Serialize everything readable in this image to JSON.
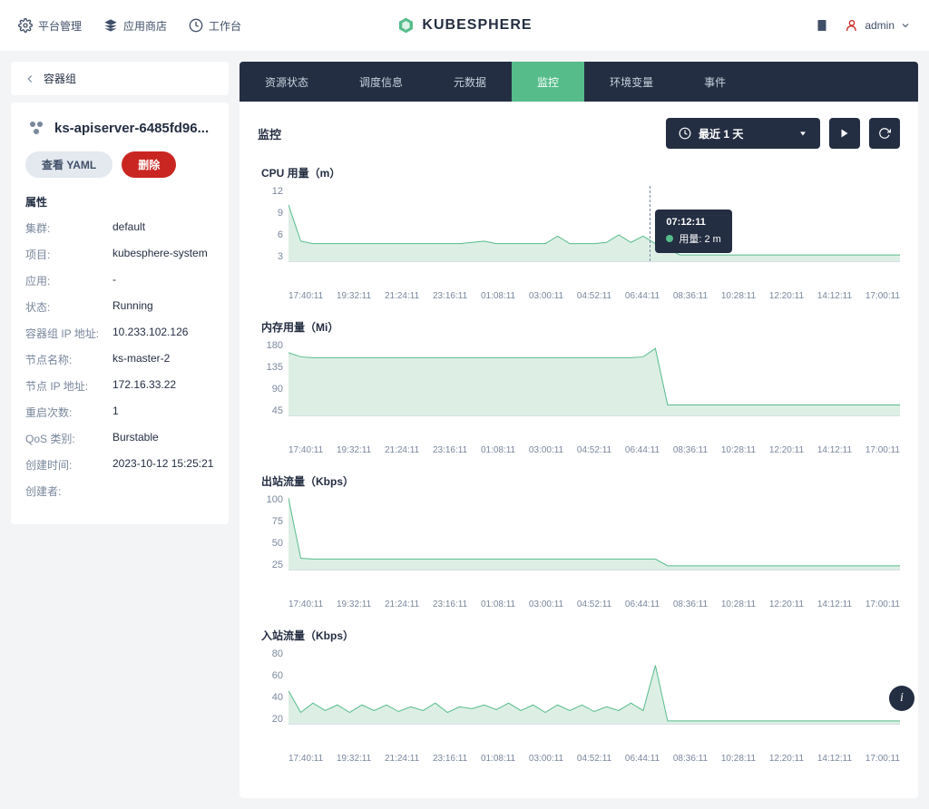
{
  "topbar": {
    "platform": "平台管理",
    "appstore": "应用商店",
    "workbench": "工作台",
    "brand": "KUBESPHERE",
    "user": "admin"
  },
  "breadcrumb": "容器组",
  "pod": {
    "name": "ks-apiserver-6485fd96..."
  },
  "buttons": {
    "yaml": "查看 YAML",
    "delete": "删除"
  },
  "attrs": {
    "title": "属性",
    "rows": [
      {
        "label": "集群:",
        "value": "default"
      },
      {
        "label": "项目:",
        "value": "kubesphere-system"
      },
      {
        "label": "应用:",
        "value": "-"
      },
      {
        "label": "状态:",
        "value": "Running"
      },
      {
        "label": "容器组 IP 地址:",
        "value": "10.233.102.126"
      },
      {
        "label": "节点名称:",
        "value": "ks-master-2"
      },
      {
        "label": "节点 IP 地址:",
        "value": "172.16.33.22"
      },
      {
        "label": "重启次数:",
        "value": "1"
      },
      {
        "label": "QoS 类别:",
        "value": "Burstable"
      },
      {
        "label": "创建时间:",
        "value": "2023-10-12 15:25:21"
      },
      {
        "label": "创建者:",
        "value": ""
      }
    ]
  },
  "tabs": [
    "资源状态",
    "调度信息",
    "元数据",
    "监控",
    "环境变量",
    "事件"
  ],
  "activeTab": 3,
  "panel": {
    "title": "监控",
    "timeRange": "最近 1 天"
  },
  "tooltip": {
    "time": "07:12:11",
    "label": "用量:",
    "value": "2 m"
  },
  "chart_data": [
    {
      "type": "area",
      "title": "CPU 用量（m）",
      "y_ticks": [
        12,
        9,
        6,
        3
      ],
      "ylim": [
        0,
        12
      ],
      "x_labels": [
        "17:40:11",
        "19:32:11",
        "21:24:11",
        "23:16:11",
        "01:08:11",
        "03:00:11",
        "04:52:11",
        "06:44:11",
        "08:36:11",
        "10:28:11",
        "12:20:11",
        "14:12:11",
        "17:00:11"
      ],
      "values": [
        9,
        3.2,
        2.8,
        2.8,
        2.8,
        2.8,
        2.8,
        2.8,
        2.8,
        2.8,
        2.8,
        2.8,
        2.8,
        2.8,
        2.8,
        3.0,
        3.2,
        2.8,
        2.8,
        2.8,
        2.8,
        2.8,
        4.0,
        2.8,
        2.8,
        2.8,
        3.0,
        4.2,
        3.0,
        4.0,
        2.8,
        2.0,
        1.0,
        1.0,
        1.0,
        1.0,
        1.0,
        1.0,
        1.0,
        1.0,
        1.0,
        1.0,
        1.0,
        1.0,
        1.0,
        1.0,
        1.0,
        1.0,
        1.0,
        1.0,
        1.0
      ]
    },
    {
      "type": "area",
      "title": "内存用量（Mi）",
      "y_ticks": [
        180,
        135,
        90,
        45
      ],
      "ylim": [
        0,
        180
      ],
      "x_labels": [
        "17:40:11",
        "19:32:11",
        "21:24:11",
        "23:16:11",
        "01:08:11",
        "03:00:11",
        "04:52:11",
        "06:44:11",
        "08:36:11",
        "10:28:11",
        "12:20:11",
        "14:12:11",
        "17:00:11"
      ],
      "values": [
        150,
        140,
        138,
        138,
        138,
        138,
        138,
        138,
        138,
        138,
        138,
        138,
        138,
        138,
        138,
        138,
        138,
        138,
        138,
        138,
        138,
        138,
        138,
        138,
        138,
        138,
        138,
        138,
        138,
        140,
        160,
        25,
        25,
        25,
        25,
        25,
        25,
        25,
        25,
        25,
        25,
        25,
        25,
        25,
        25,
        25,
        25,
        25,
        25,
        25,
        25
      ]
    },
    {
      "type": "area",
      "title": "出站流量（Kbps）",
      "y_ticks": [
        100,
        75,
        50,
        25
      ],
      "ylim": [
        0,
        100
      ],
      "x_labels": [
        "17:40:11",
        "19:32:11",
        "21:24:11",
        "23:16:11",
        "01:08:11",
        "03:00:11",
        "04:52:11",
        "06:44:11",
        "08:36:11",
        "10:28:11",
        "12:20:11",
        "14:12:11",
        "17:00:11"
      ],
      "values": [
        95,
        15,
        14,
        14,
        14,
        14,
        14,
        14,
        14,
        14,
        14,
        14,
        14,
        14,
        14,
        14,
        14,
        14,
        14,
        14,
        14,
        14,
        14,
        14,
        14,
        14,
        14,
        14,
        14,
        14,
        14,
        5,
        5,
        5,
        5,
        5,
        5,
        5,
        5,
        5,
        5,
        5,
        5,
        5,
        5,
        5,
        5,
        5,
        5,
        5,
        5
      ]
    },
    {
      "type": "area",
      "title": "入站流量（Kbps）",
      "y_ticks": [
        80,
        60,
        40,
        20
      ],
      "ylim": [
        0,
        80
      ],
      "x_labels": [
        "17:40:11",
        "19:32:11",
        "21:24:11",
        "23:16:11",
        "01:08:11",
        "03:00:11",
        "04:52:11",
        "06:44:11",
        "08:36:11",
        "10:28:11",
        "12:20:11",
        "14:12:11",
        "17:00:11"
      ],
      "values": [
        35,
        12,
        22,
        14,
        20,
        12,
        20,
        14,
        20,
        13,
        18,
        14,
        22,
        12,
        18,
        16,
        20,
        15,
        22,
        14,
        20,
        12,
        20,
        14,
        20,
        13,
        18,
        14,
        22,
        14,
        62,
        3,
        3,
        3,
        3,
        3,
        3,
        3,
        3,
        3,
        3,
        3,
        3,
        3,
        3,
        3,
        3,
        3,
        3,
        3,
        3
      ]
    }
  ]
}
